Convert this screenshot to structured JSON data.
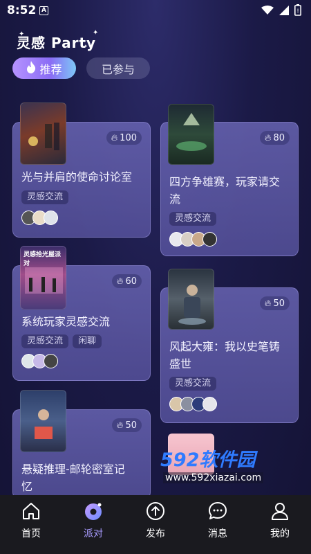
{
  "status_bar": {
    "time": "8:52",
    "notification_icon": "a-icon"
  },
  "header": {
    "title": "灵感 Party"
  },
  "tabs": [
    {
      "label": "推荐",
      "icon": "flame-icon",
      "active": true
    },
    {
      "label": "已参与",
      "active": false
    }
  ],
  "cards": [
    {
      "title": "光与并肩的使命讨论室",
      "heat": "100",
      "tags": [
        "灵感交流"
      ]
    },
    {
      "title": "四方争雄赛，玩家请交",
      "title_line2": "流",
      "heat": "80",
      "tags": [
        "灵感交流"
      ]
    },
    {
      "title": "系统玩家灵感交流",
      "heat": "60",
      "tags": [
        "灵感交流",
        "闲聊"
      ],
      "cover_text": "灵感拾光屋派对"
    },
    {
      "title": "风起大雍：我以史笔铸",
      "title_line2": "盛世",
      "heat": "50",
      "tags": [
        "灵感交流"
      ]
    },
    {
      "title": "悬疑推理-邮轮密室记",
      "title_line2": "忆",
      "heat": "50",
      "tags": []
    }
  ],
  "watermark": {
    "brand_num": "592",
    "brand_cn": "软件园",
    "url": "www.592xiazai.com"
  },
  "bottom_nav": [
    {
      "label": "首页",
      "icon": "home-icon",
      "active": false
    },
    {
      "label": "派对",
      "icon": "party-icon",
      "active": true
    },
    {
      "label": "发布",
      "icon": "publish-icon",
      "active": false
    },
    {
      "label": "消息",
      "icon": "message-icon",
      "active": false
    },
    {
      "label": "我的",
      "icon": "profile-icon",
      "active": false
    }
  ],
  "colors": {
    "accent": "#a89bff",
    "background": "#1b1a47",
    "card": "#625ea8",
    "watermark_blue": "#2f7bff"
  }
}
